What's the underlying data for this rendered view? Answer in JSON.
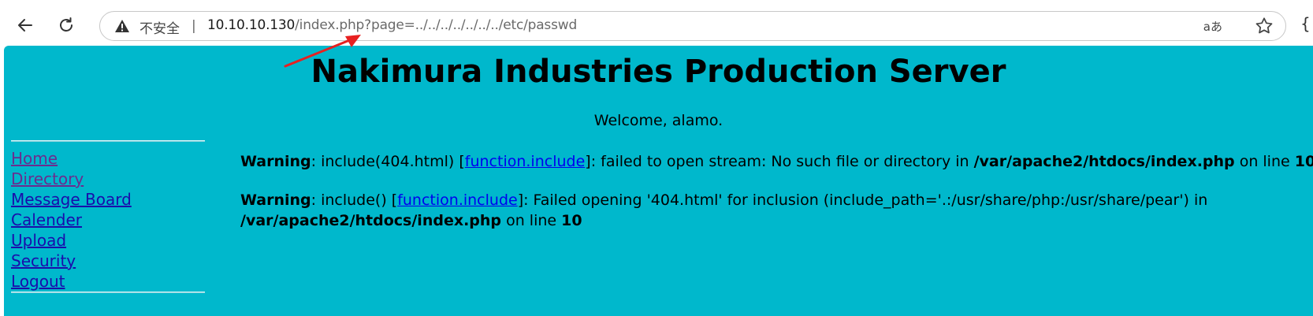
{
  "browser": {
    "security_label": "不安全",
    "url_host": "10.10.10.130",
    "url_path": "/index.php?page=../../../../../../../etc/passwd",
    "translate_label": "aあ"
  },
  "page": {
    "title": "Nakimura Industries Production Server",
    "welcome": "Welcome, alamo.",
    "background_color": "#00b8cc",
    "menu": [
      {
        "label": "Home"
      },
      {
        "label": "Directory"
      },
      {
        "label": "Message Board"
      },
      {
        "label": "Calender"
      },
      {
        "label": "Upload"
      },
      {
        "label": "Security"
      },
      {
        "label": "Logout"
      }
    ],
    "warning1": {
      "label": "Warning",
      "text_a": ": include(404.html) [",
      "link": "function.include",
      "text_b": "]: failed to open stream: No such file or directory in ",
      "file": "/var/apache2/htdocs/index.php",
      "text_c": " on line ",
      "line": "10"
    },
    "warning2": {
      "label": "Warning",
      "text_a": ": include() [",
      "link": "function.include",
      "text_b": "]: Failed opening '404.html' for inclusion (include_path='.:/usr/share/php:/usr/share/pear') in",
      "file": "/var/apache2/htdocs/index.php",
      "text_c": " on line ",
      "line": "10"
    }
  }
}
